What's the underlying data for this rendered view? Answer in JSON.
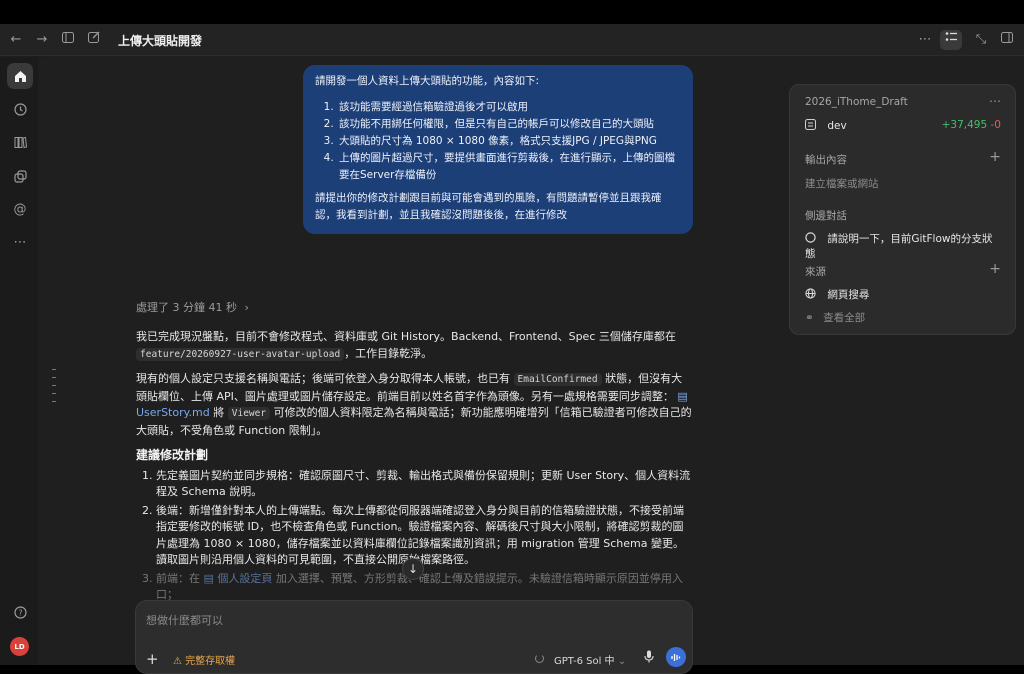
{
  "window": {
    "title": "上傳大頭貼開發"
  },
  "rail": {
    "avatar_initials": "LD"
  },
  "user_message": {
    "intro": "請開發一個人資料上傳大頭貼的功能，內容如下:",
    "items": [
      "該功能需要經過信箱驗證過後才可以啟用",
      "該功能不用綁任何權限，但是只有自己的帳戶可以修改自己的大頭貼",
      "大頭貼的尺寸為 1080 × 1080 像素，格式只支援JPG / JPEG與PNG",
      "上傳的圖片超過尺寸，要提供畫面進行剪裁後，在進行顯示，上傳的圖檔要在Server存檔備份"
    ],
    "request": "請提出你的修改計劃跟目前與可能會遇到的風險，有問題請暫停並且跟我確認，我看到計劃，並且我確認沒問題後後，在進行修改"
  },
  "thinking": {
    "label": "處理了 3 分鐘 41 秒",
    "chevron": "›"
  },
  "response": {
    "p1_a": "我已完成現況盤點，目前不會修改程式、資料庫或 Git History。Backend、Frontend、Spec 三個儲存庫都在",
    "p1_code": "feature/20260927-user-avatar-upload",
    "p1_b": "，工作目錄乾淨。",
    "p2_a": "現有的個人設定只支援名稱與電話；後端可依登入身分取得本人帳號，也已有",
    "p2_code1": "EmailConfirmed",
    "p2_b": "狀態，但沒有大頭貼欄位、上傳 API、圖片處理或圖片儲存設定。前端目前以姓名首字作為頭像。另有一處規格需要同步調整：",
    "p2_link": "UserStory.md",
    "p2_c": "將",
    "p2_code2": "Viewer",
    "p2_d": "可修改的個人資料限定為名稱與電話；新功能應明確增列「信箱已驗證者可修改自己的大頭貼，不受角色或 Function 限制」。",
    "plan_heading": "建議修改計劃",
    "plan": [
      "先定義圖片契約並同步規格：確認原圖尺寸、剪裁、輸出格式與備份保留規則；更新 User Story、個人資料流程及 Schema 說明。",
      "後端：新增僅針對本人的上傳端點。每次上傳都從伺服器端確認登入身分與目前的信箱驗證狀態，不接受前端指定要修改的帳號 ID，也不檢查角色或 Function。驗證檔案內容、解碼後尺寸與大小限制，將確認剪裁的圖片處理為 1080 × 1080，儲存檔案並以資料庫欄位記錄檔案識別資訊；用 migration 管理 Schema 變更。讀取圖片則沿用個人資料的可見範圍，不直接公開原始檔案路徑。"
    ],
    "plan3_a": "前端：在",
    "plan3_link": "個人設定頁",
    "plan3_b": "加入選擇、預覽、方形剪裁、確認上傳及錯誤提示。未驗證信箱時顯示原因並停用入口；"
  },
  "composer": {
    "placeholder": "想做什麼都可以",
    "access_label": "完整存取權",
    "model_label": "GPT-6 Sol 中"
  },
  "panel": {
    "project": "2026_iThome_Draft",
    "branch": "dev",
    "additions": "+37,495",
    "deletions": "-0",
    "output_title": "輸出內容",
    "output_hint": "建立檔案或網站",
    "side_chat_title": "側邊對話",
    "side_chat_item": "請說明一下，目前GitFlow的分支狀態",
    "sources_title": "來源",
    "web_search": "網頁搜尋",
    "view_all": "查看全部"
  },
  "colors": {
    "user_bubble": "#1d3f78",
    "accent_blue": "#3c6fd8",
    "additions_green": "#43c06b",
    "deletions_red": "#e45a5a",
    "access_orange": "#e9a64a",
    "avatar_red": "#d9423a"
  }
}
